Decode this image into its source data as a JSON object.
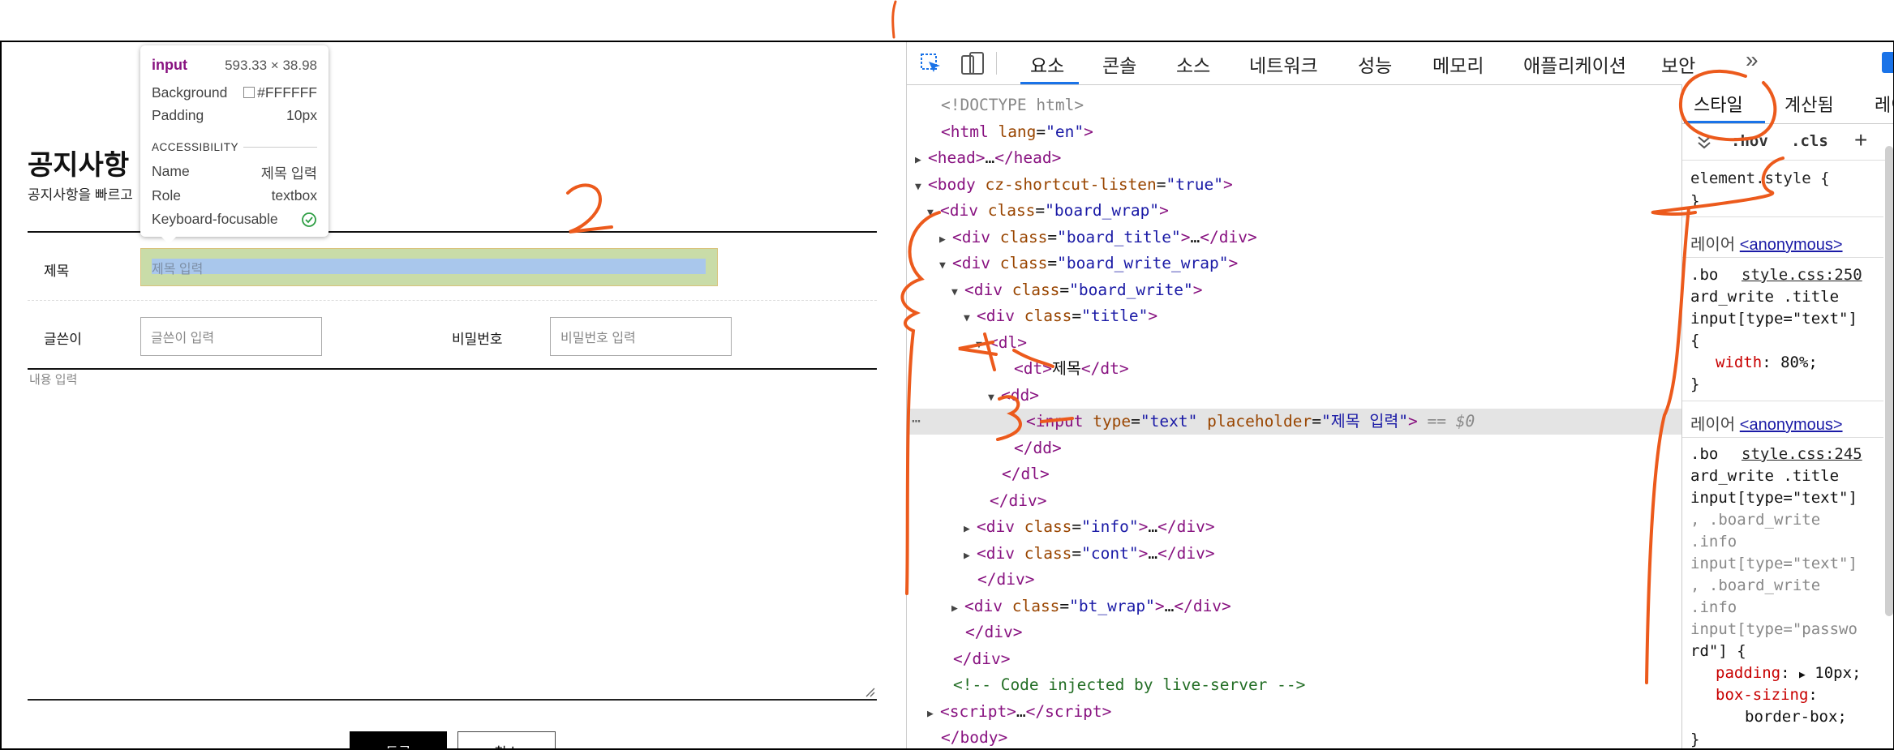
{
  "page": {
    "title": "공지사항",
    "subtitle": "공지사항을 빠르고"
  },
  "form": {
    "title_label": "제목",
    "title_placeholder": "제목 입력",
    "writer_label": "글쓴이",
    "writer_placeholder": "글쓴이 입력",
    "password_label": "비밀번호",
    "password_placeholder": "비밀번호 입력",
    "content_placeholder": "내용 입력",
    "submit_label": "등록",
    "cancel_label": "취소"
  },
  "tooltip": {
    "tag": "input",
    "size": "593.33 × 38.98",
    "background_label": "Background",
    "background_value": "#FFFFFF",
    "padding_label": "Padding",
    "padding_value": "10px",
    "section": "ACCESSIBILITY",
    "name_label": "Name",
    "name_value": "제목 입력",
    "role_label": "Role",
    "role_value": "textbox",
    "focus_label": "Keyboard-focusable"
  },
  "devtools": {
    "tabs": [
      "요소",
      "콘솔",
      "소스",
      "네트워크",
      "성능",
      "메모리",
      "애플리케이션",
      "보안"
    ],
    "more": "»",
    "side_tabs": [
      "스타일",
      "계산됨",
      "레이"
    ],
    "filter": {
      "hov": ":hov",
      "cls": ".cls",
      "add": "+"
    },
    "accent": "#1a73e8"
  },
  "dom_lines": [
    {
      "ind": 0,
      "html": "<span class='gray'>&lt;!DOCTYPE html&gt;</span>"
    },
    {
      "ind": 0,
      "html": "<span class='tag'>&lt;html</span> <span class='attr'>lang</span>=<span class='val'>\"en\"</span><span class='tag'>&gt;</span>"
    },
    {
      "ind": 0,
      "tri": "▶",
      "html": "<span class='tag'>&lt;head&gt;</span>…<span class='tag'>&lt;/head&gt;</span>"
    },
    {
      "ind": 0,
      "tri": "▼",
      "html": "<span class='tag'>&lt;body</span> <span class='attr'>cz-shortcut-listen</span>=<span class='val'>\"true\"</span><span class='tag'>&gt;</span>"
    },
    {
      "ind": 1,
      "tri": "▼",
      "html": "<span class='tag'>&lt;div</span> <span class='attr'>class</span>=<span class='val'>\"board_wrap\"</span><span class='tag'>&gt;</span>"
    },
    {
      "ind": 2,
      "tri": "▶",
      "html": "<span class='tag'>&lt;div</span> <span class='attr'>class</span>=<span class='val'>\"board_title\"</span><span class='tag'>&gt;</span>…<span class='tag'>&lt;/div&gt;</span>"
    },
    {
      "ind": 2,
      "tri": "▼",
      "html": "<span class='tag'>&lt;div</span> <span class='attr'>class</span>=<span class='val'>\"board_write_wrap\"</span><span class='tag'>&gt;</span>"
    },
    {
      "ind": 3,
      "tri": "▼",
      "html": "<span class='tag'>&lt;div</span> <span class='attr'>class</span>=<span class='val'>\"board_write\"</span><span class='tag'>&gt;</span>"
    },
    {
      "ind": 4,
      "tri": "▼",
      "html": "<span class='tag'>&lt;div</span> <span class='attr'>class</span>=<span class='val'>\"title\"</span><span class='tag'>&gt;</span>"
    },
    {
      "ind": 5,
      "tri": "▼",
      "html": "<span class='tag'>&lt;dl&gt;</span>"
    },
    {
      "ind": 6,
      "html": "<span class='tag'>&lt;dt&gt;</span>제목<span class='tag'>&lt;/dt&gt;</span>"
    },
    {
      "ind": 6,
      "tri": "▼",
      "html": "<span class='tag'>&lt;dd&gt;</span>"
    },
    {
      "ind": 7,
      "hl": true,
      "html": "<span class='tag'>&lt;input</span> <span class='attr'>type</span>=<span class='val'>\"text\"</span> <span class='attr'>placeholder</span>=<span class='val'>\"제목 입력\"</span><span class='tag'>&gt;</span> <span class='gray'><i>== $0</i></span>"
    },
    {
      "ind": 6,
      "html": "<span class='tag'>&lt;/dd&gt;</span>"
    },
    {
      "ind": 5,
      "html": "<span class='tag'>&lt;/dl&gt;</span>"
    },
    {
      "ind": 4,
      "html": "<span class='tag'>&lt;/div&gt;</span>"
    },
    {
      "ind": 4,
      "tri": "▶",
      "html": "<span class='tag'>&lt;div</span> <span class='attr'>class</span>=<span class='val'>\"info\"</span><span class='tag'>&gt;</span>…<span class='tag'>&lt;/div&gt;</span>"
    },
    {
      "ind": 4,
      "tri": "▶",
      "html": "<span class='tag'>&lt;div</span> <span class='attr'>class</span>=<span class='val'>\"cont\"</span><span class='tag'>&gt;</span>…<span class='tag'>&lt;/div&gt;</span>"
    },
    {
      "ind": 3,
      "html": "<span class='tag'>&lt;/div&gt;</span>"
    },
    {
      "ind": 3,
      "tri": "▶",
      "html": "<span class='tag'>&lt;div</span> <span class='attr'>class</span>=<span class='val'>\"bt_wrap\"</span><span class='tag'>&gt;</span>…<span class='tag'>&lt;/div&gt;</span>"
    },
    {
      "ind": 2,
      "html": "<span class='tag'>&lt;/div&gt;</span>"
    },
    {
      "ind": 1,
      "html": "<span class='tag'>&lt;/div&gt;</span>"
    },
    {
      "ind": 1,
      "html": "<span class='cmt'>&lt;!-- Code injected by live-server --&gt;</span>"
    },
    {
      "ind": 1,
      "tri": "▶",
      "html": "<span class='tag'>&lt;script&gt;</span>…<span class='tag'>&lt;/script&gt;</span>"
    },
    {
      "ind": 0,
      "html": "<span class='tag'>&lt;/body&gt;</span>"
    }
  ],
  "styles": {
    "element_style": "element.style {",
    "close_brace": "}",
    "layer_label": "레이어",
    "layer_link": "<anonymous>",
    "rule1": {
      "sel_a": ".bo",
      "file": "style.css:250",
      "sel_lines": [
        "ard_write .title",
        "input[type=\"text\"]",
        "{"
      ],
      "prop": "width",
      "value": "80%;"
    },
    "rule2": {
      "sel_a": ".bo",
      "file": "style.css:245",
      "sel_lines": [
        "ard_write .title",
        "input[type=\"text\"]",
        ", .board_write",
        ".info",
        "input[type=\"text\"]",
        ", .board_write",
        ".info",
        "input[type=\"passwo",
        "rd\"] {"
      ],
      "prop1": "padding",
      "value1": "10px;",
      "prop2": "box-sizing",
      "value2": "border-box;"
    }
  },
  "annotations": [
    "2",
    "4",
    "3"
  ],
  "colors": {
    "ink": "#ec5a1c",
    "highlight_margin": "#c9dca8",
    "highlight_content": "#a9c7ec",
    "tooltip_tag": "#881280"
  }
}
